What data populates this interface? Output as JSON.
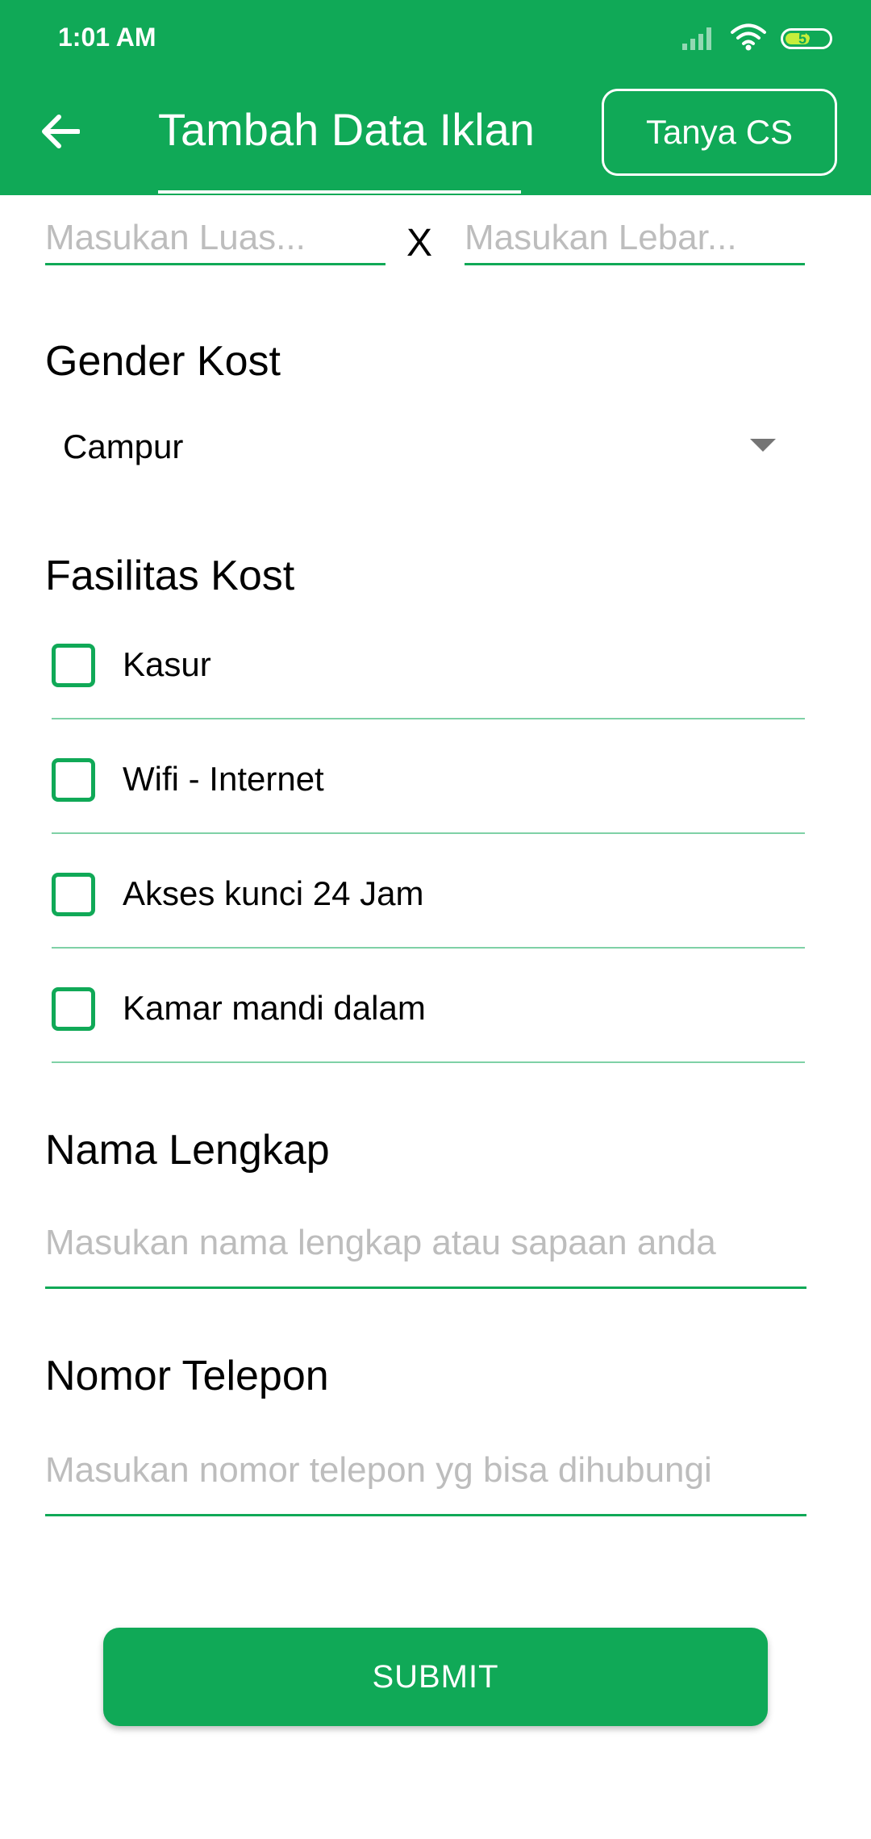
{
  "status_bar": {
    "time": "1:01 AM",
    "battery": "57",
    "battery_fraction": 0.57
  },
  "app_bar": {
    "back_icon": "arrow-left-icon",
    "title": "Tambah Data Iklan",
    "cs_button": "Tanya CS"
  },
  "room_size": {
    "luas_placeholder": "Masukan Luas...",
    "separator": "X",
    "lebar_placeholder": "Masukan Lebar..."
  },
  "gender": {
    "heading": "Gender Kost",
    "selected": "Campur"
  },
  "facilities": {
    "heading": "Fasilitas Kost",
    "items": [
      {
        "label": "Kasur",
        "checked": false
      },
      {
        "label": "Wifi - Internet",
        "checked": false
      },
      {
        "label": "Akses kunci 24 Jam",
        "checked": false
      },
      {
        "label": "Kamar mandi dalam",
        "checked": false
      }
    ]
  },
  "full_name": {
    "heading": "Nama Lengkap",
    "placeholder": "Masukan nama lengkap atau sapaan anda"
  },
  "phone": {
    "heading": "Nomor Telepon",
    "placeholder": "Masukan nomor telepon yg bisa dihubungi"
  },
  "submit_label": "SUBMIT",
  "colors": {
    "primary": "#10a957",
    "divider": "#7fd1a6",
    "placeholder": "#bdbdbd",
    "battery_fill": "#c6ee3b"
  }
}
